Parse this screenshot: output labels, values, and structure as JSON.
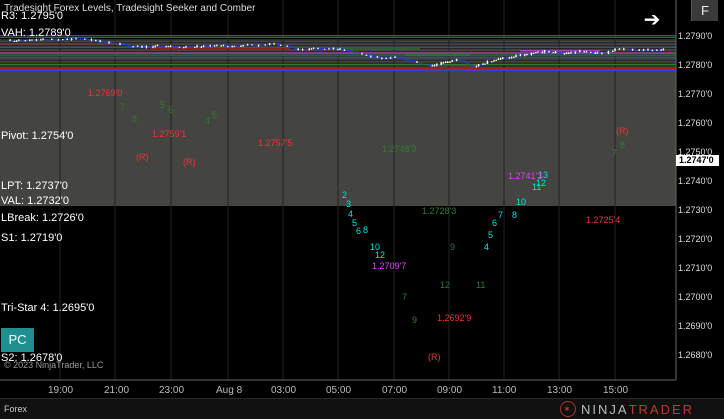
{
  "chart_title": "Tradesight Forex Levels, Tradesight Seeker and Comber",
  "top_overlap_text": "R3: 1.2795'0",
  "levels": [
    {
      "label": "VAH: 1.2789'0",
      "value": 1.2789
    },
    {
      "label": "Pivot: 1.2754'0",
      "value": 1.2754
    },
    {
      "label": "LPT: 1.2737'0",
      "value": 1.2737
    },
    {
      "label": "VAL: 1.2732'0",
      "value": 1.2732
    },
    {
      "label": "LBreak: 1.2726'0",
      "value": 1.2726
    },
    {
      "label": "S1: 1.2719'0",
      "value": 1.2719
    },
    {
      "label": "Tri-Star 4: 1.2695'0",
      "value": 1.2695
    },
    {
      "label": "S2: 1.2678'0",
      "value": 1.2678
    }
  ],
  "price_axis": [
    "1.2790'0",
    "1.2780'0",
    "1.2770'0",
    "1.2760'0",
    "1.2750'0",
    "1.2740'0",
    "1.2730'0",
    "1.2720'0",
    "1.2710'0",
    "1.2700'0",
    "1.2690'0",
    "1.2680'0"
  ],
  "current_price": "1.2747'0",
  "time_axis": [
    "19:00",
    "21:00",
    "23:00",
    "Aug 8",
    "03:00",
    "05:00",
    "07:00",
    "09:00",
    "11:00",
    "13:00",
    "15:00"
  ],
  "annotations": [
    {
      "text": "1.2769'0",
      "color": "#e53935"
    },
    {
      "text": "1.2759'1",
      "color": "#e53935"
    },
    {
      "text": "1.2757'5",
      "color": "#e53935"
    },
    {
      "text": "1.2748'0",
      "color": "#2e7d32"
    },
    {
      "text": "1.2728'3",
      "color": "#2e7d32"
    },
    {
      "text": "1.2709'7",
      "color": "#e040fb"
    },
    {
      "text": "1.2692'9",
      "color": "#e53935"
    },
    {
      "text": "1.2741'3",
      "color": "#e040fb"
    },
    {
      "text": "1.2725'4",
      "color": "#e53935"
    }
  ],
  "r_markers": [
    "(R)",
    "(R)",
    "(R)",
    "(R)"
  ],
  "pc_button": "PC",
  "f_button": "F",
  "copyright": "© 2023 NinjaTrader, LLC",
  "instrument_tab": "Forex",
  "logo": {
    "ninja": "NINJA",
    "trader": "TRADER"
  },
  "price_series": {
    "x": [
      "18:00",
      "19:00",
      "20:00",
      "21:00",
      "22:00",
      "23:00",
      "00:00",
      "01:00",
      "02:00",
      "03:00",
      "04:00",
      "05:00",
      "06:00",
      "07:00",
      "08:00",
      "08:30",
      "09:00",
      "09:30",
      "10:00",
      "11:00",
      "12:00",
      "13:00",
      "14:00",
      "15:00",
      "16:00"
    ],
    "close": [
      1.2779,
      1.2781,
      1.2784,
      1.2772,
      1.2759,
      1.2762,
      1.2758,
      1.2764,
      1.2761,
      1.2766,
      1.2755,
      1.2748,
      1.2733,
      1.2718,
      1.2699,
      1.269,
      1.2702,
      1.2696,
      1.269,
      1.2718,
      1.2734,
      1.2741,
      1.2736,
      1.2742,
      1.2746
    ]
  },
  "colors": {
    "background": "#000000",
    "value_area": "#444440",
    "candle_up": "#ffffff",
    "candle_down": "#1e3ff0",
    "accent": "#1f8f8f"
  }
}
